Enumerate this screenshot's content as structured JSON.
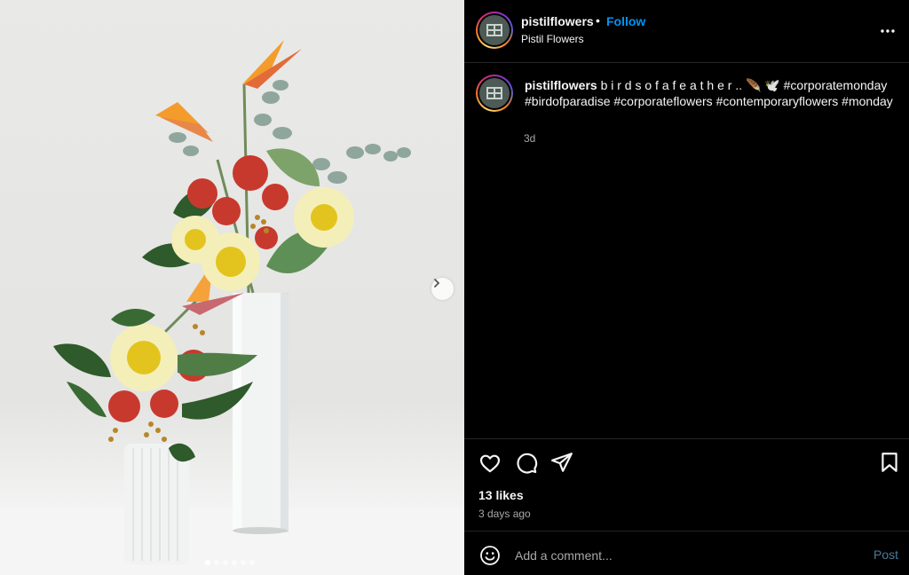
{
  "post": {
    "username": "pistilflowers",
    "separator": "•",
    "follow_label": "Follow",
    "account_name": "Pistil Flowers",
    "caption_text": "b i r d s o f a f e a t h e r .. 🪶 🕊️ #corporatemonday #birdofparadise #corporateflowers #contemporaryflowers #monday",
    "caption_age": "3d",
    "likes": "13 likes",
    "posted_ago": "3 days ago",
    "comment_placeholder": "Add a comment...",
    "post_label": "Post"
  },
  "carousel": {
    "current_index": 1,
    "total_slides": 6
  },
  "icons": [
    "more-options-icon",
    "heart-icon",
    "comment-icon",
    "share-icon",
    "bookmark-icon",
    "emoji-icon",
    "chevron-right-icon"
  ],
  "colors": {
    "accent": "#0095f6",
    "background": "#000000",
    "muted_text": "#a8a8a8",
    "post_disabled": "#4c7a9a"
  }
}
